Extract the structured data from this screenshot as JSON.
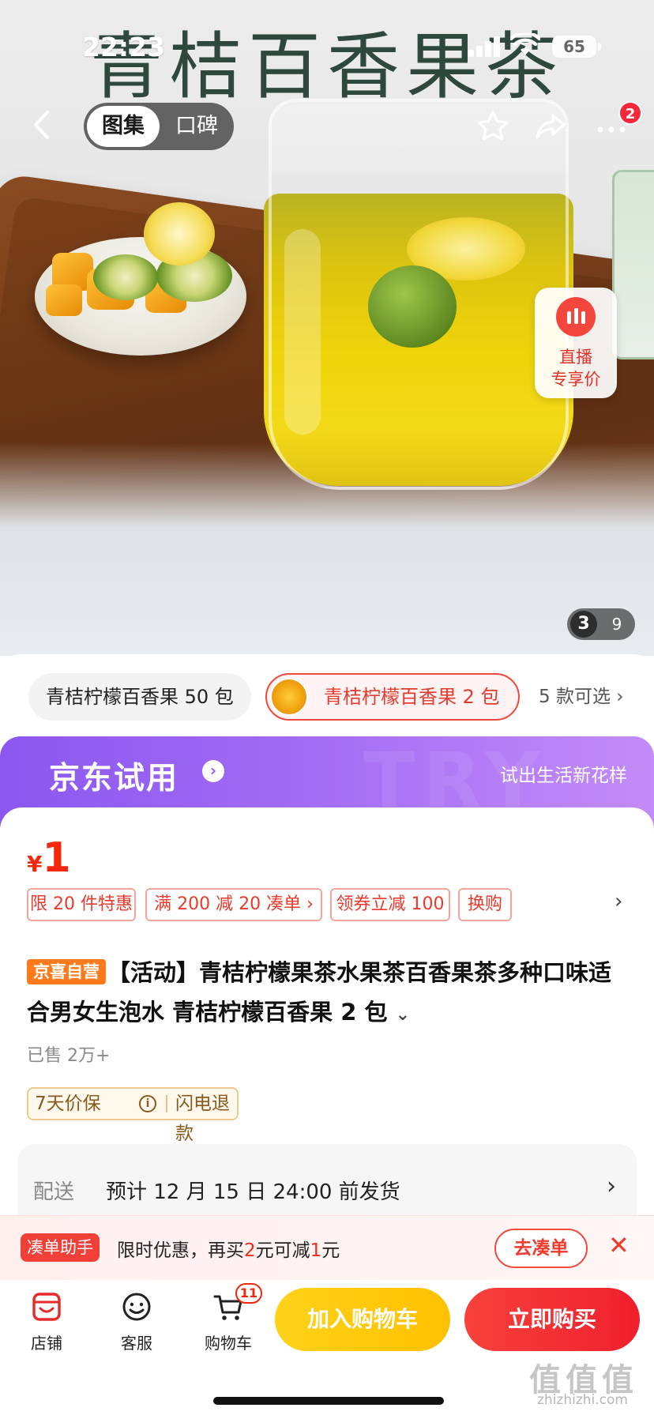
{
  "status_bar": {
    "time": "22:23",
    "battery": "65"
  },
  "hero": {
    "overlay_title": "青桔百香果茶",
    "segment": {
      "active": "图集",
      "inactive": "口碑"
    },
    "notification_count": "2",
    "live_badge": {
      "line1": "直播",
      "line2": "专享价"
    },
    "pager": {
      "current": "3",
      "total": "9"
    }
  },
  "variants": {
    "items": [
      {
        "label": "青桔柠檬百香果 50 包",
        "selected": false
      },
      {
        "label": "青桔柠檬百香果 2 包",
        "selected": true
      }
    ],
    "more_label": "5 款可选 ›"
  },
  "trial_banner": {
    "title": "京东试用",
    "arrow": "›",
    "slogan": "试出生活新花样",
    "watermark": "TRY"
  },
  "product": {
    "price_symbol": "¥",
    "price": "1",
    "promos": [
      "限 20 件特惠",
      "满 200 减 20 凑单 ›",
      "领券立减 100",
      "换购"
    ],
    "promo_more": "›",
    "self_tag": "京喜自营",
    "title": "【活动】青桔柠檬果茶水果茶百香果茶多种口味适合男女生泡水 青桔柠檬百香果 2 包",
    "title_chevron": "⌄",
    "sold": "已售 2万+",
    "guarantee": {
      "left": "7天价保",
      "info": "i",
      "right": "闪电退款"
    }
  },
  "delivery": {
    "label": "配送",
    "text": "预计 12 月 15 日 24:00 前发货",
    "arrow": "›"
  },
  "bundle": {
    "tag": "凑单助手",
    "text_a": "限时优惠，再买",
    "amount_a": "2",
    "text_b": "元可减",
    "amount_b": "1",
    "text_c": "元",
    "button": "去凑单",
    "close": "✕"
  },
  "bottom_bar": {
    "tabs": [
      {
        "label": "店铺",
        "icon": "store-icon"
      },
      {
        "label": "客服",
        "icon": "customer-service-icon"
      },
      {
        "label": "购物车",
        "icon": "cart-icon",
        "badge": "11"
      }
    ],
    "add_to_cart": "加入购物车",
    "buy_now": "立即购买"
  },
  "watermark": {
    "main": "值值值",
    "sub": "zhizhizhi.com"
  }
}
